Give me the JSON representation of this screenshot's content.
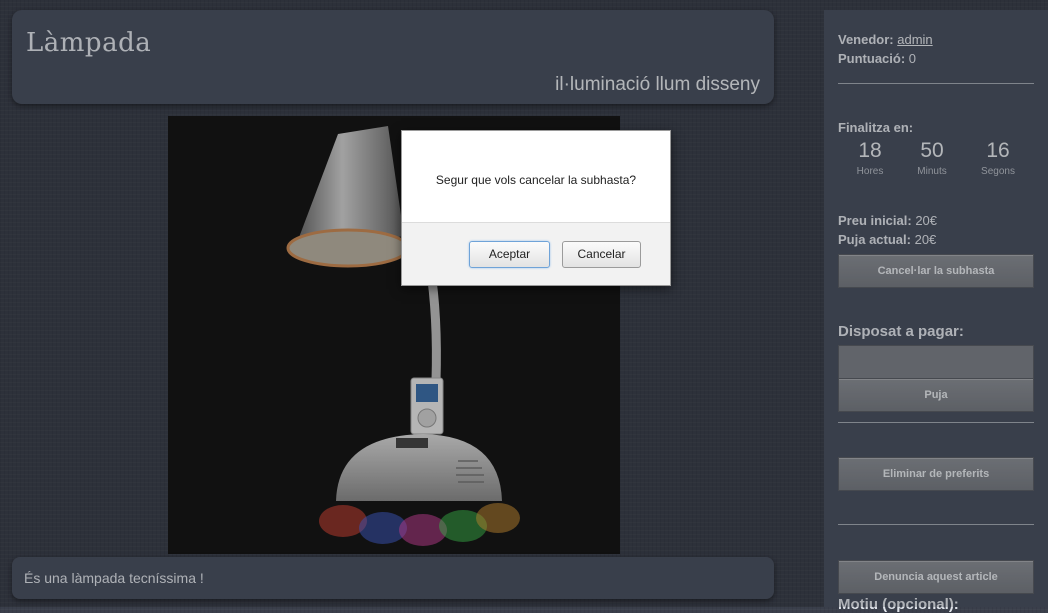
{
  "product": {
    "title": "Làmpada",
    "tags": "il·luminació llum disseny",
    "description": "És una làmpada tecníssima !"
  },
  "seller": {
    "label": "Venedor:",
    "name": "admin",
    "rating_label": "Puntuació:",
    "rating": "0"
  },
  "countdown": {
    "heading": "Finalitza en:",
    "hours": "18",
    "hours_label": "Hores",
    "minutes": "50",
    "minutes_label": "Minuts",
    "seconds": "16",
    "seconds_label": "Segons"
  },
  "prices": {
    "initial_label": "Preu inicial:",
    "initial": "20€",
    "current_label": "Puja actual:",
    "current": "20€"
  },
  "actions": {
    "cancel_auction": "Cancel·lar la subhasta",
    "willing_label": "Disposat a pagar:",
    "bid_input_value": "",
    "bid": "Puja",
    "remove_favorites": "Eliminar de preferits",
    "report": "Denuncia aquest article",
    "reason_label": "Motiu (opcional):"
  },
  "dialog": {
    "message": "Segur que vols cancelar la subhasta?",
    "accept": "Aceptar",
    "cancel": "Cancelar"
  },
  "colors": {
    "panel": "#4a5160",
    "background": "#3a3f4b",
    "button": "#808389",
    "focus_border": "#6fa3d8"
  }
}
